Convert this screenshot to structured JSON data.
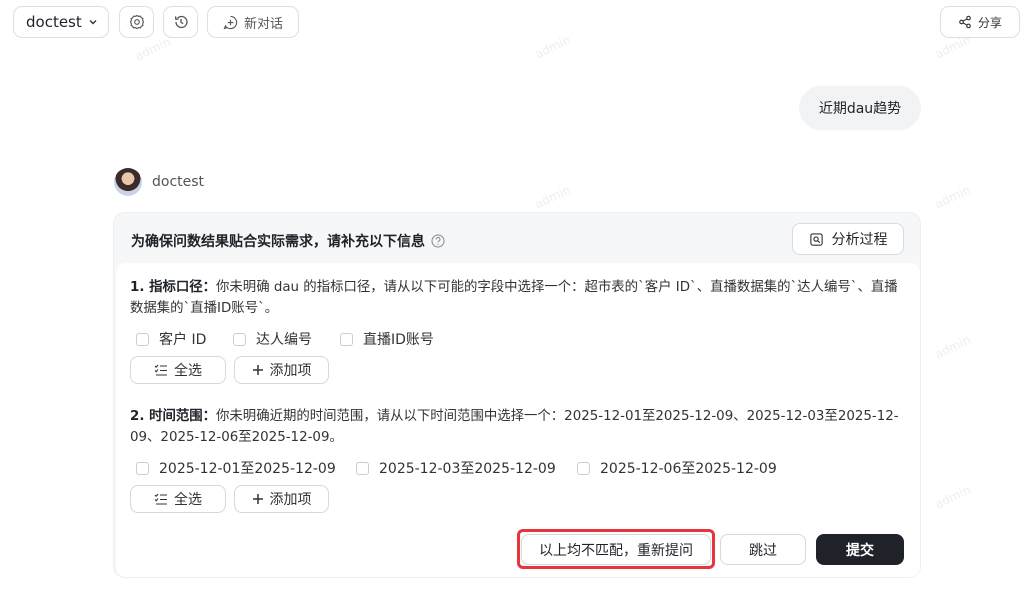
{
  "header": {
    "project_name": "doctest",
    "new_chat_label": "新对话",
    "share_label": "分享"
  },
  "watermark": "admin",
  "user_message": "近期dau趋势",
  "bot": {
    "name": "doctest"
  },
  "card": {
    "title": "为确保问数结果贴合实际需求，请补充以下信息",
    "analysis_button": "分析过程",
    "questions": [
      {
        "number": "1. 指标口径：",
        "text": "你未明确 dau 的指标口径，请从以下可能的字段中选择一个：超市表的`客户 ID`、直播数据集的`达人编号`、直播数据集的`直播ID账号`。",
        "options": [
          "客户 ID",
          "达人编号",
          "直播ID账号"
        ],
        "select_all": "全选",
        "add_item": "添加项"
      },
      {
        "number": "2. 时间范围：",
        "text": "你未明确近期的时间范围，请从以下时间范围中选择一个：2025-12-01至2025-12-09、2025-12-03至2025-12-09、2025-12-06至2025-12-09。",
        "options": [
          "2025-12-01至2025-12-09",
          "2025-12-03至2025-12-09",
          "2025-12-06至2025-12-09"
        ],
        "select_all": "全选",
        "add_item": "添加项"
      }
    ],
    "rephrase_button": "以上均不匹配，重新提问",
    "skip_button": "跳过",
    "submit_button": "提交"
  },
  "colors": {
    "highlight": "#e8343a",
    "submit_bg": "#1f2329",
    "card_bg": "#f6f7f9"
  }
}
